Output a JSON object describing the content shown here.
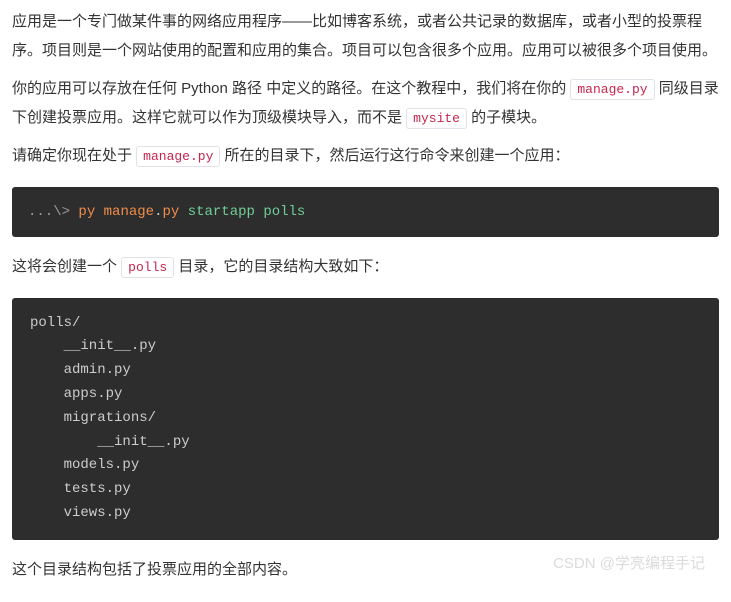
{
  "paragraphs": {
    "p1_part1": "应用是一个专门做某件事的网络应用程序——比如博客系统，或者公共记录的数据库，或者小型的投票程序。项目则是一个网站使用的配置和应用的集合。项目可以包含很多个应用。应用可以被很多个项目使用。",
    "p2_part1": "你的应用可以存放在任何 Python 路径 中定义的路径。在这个教程中，我们将在你的 ",
    "p2_code1": "manage.py",
    "p2_part2": " 同级目录下创建投票应用。这样它就可以作为顶级模块导入，而不是 ",
    "p2_code2": "mysite",
    "p2_part3": " 的子模块。",
    "p3_part1": "请确定你现在处于 ",
    "p3_code1": "manage.py",
    "p3_part2": " 所在的目录下，然后运行这行命令来创建一个应用：",
    "p4_part1": "这将会创建一个 ",
    "p4_code1": "polls",
    "p4_part2": " 目录，它的目录结构大致如下：",
    "p5": "这个目录结构包括了投票应用的全部内容。"
  },
  "command": {
    "prompt": "...\\> ",
    "py": "py",
    "manage": "manage",
    "dot": ".",
    "ext": "py",
    "startapp": "startapp",
    "polls": "polls"
  },
  "tree": "polls/\n    __init__.py\n    admin.py\n    apps.py\n    migrations/\n        __init__.py\n    models.py\n    tests.py\n    views.py",
  "watermark": "CSDN @学亮编程手记"
}
